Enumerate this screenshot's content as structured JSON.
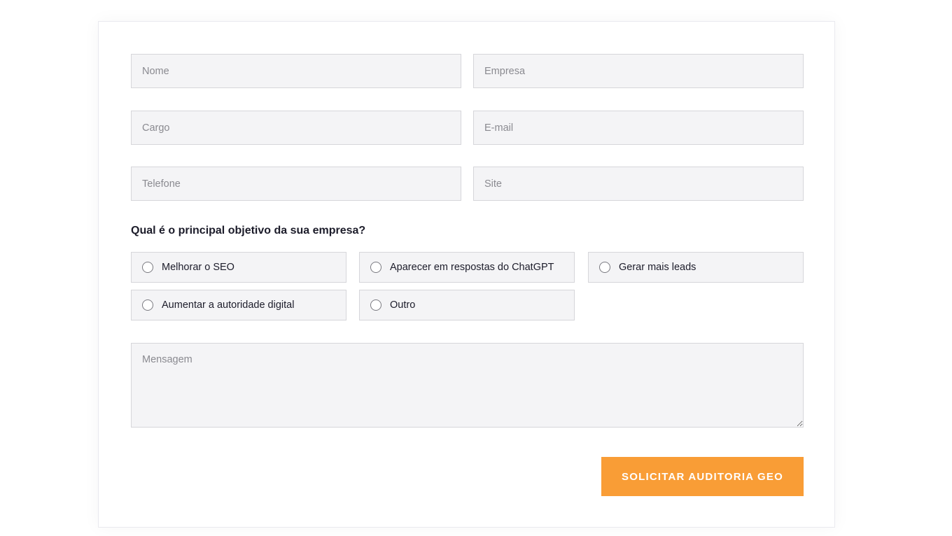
{
  "form": {
    "fields": {
      "nome": {
        "placeholder": "Nome",
        "value": ""
      },
      "empresa": {
        "placeholder": "Empresa",
        "value": ""
      },
      "cargo": {
        "placeholder": "Cargo",
        "value": ""
      },
      "email": {
        "placeholder": "E-mail",
        "value": ""
      },
      "telefone": {
        "placeholder": "Telefone",
        "value": ""
      },
      "site": {
        "placeholder": "Site",
        "value": ""
      }
    },
    "question": "Qual é o principal objetivo da sua empresa?",
    "options": [
      {
        "label": "Melhorar o SEO",
        "selected": false
      },
      {
        "label": "Aparecer em respostas do ChatGPT",
        "selected": false
      },
      {
        "label": "Gerar mais leads",
        "selected": false
      },
      {
        "label": "Aumentar a autoridade digital",
        "selected": false
      },
      {
        "label": "Outro",
        "selected": false
      }
    ],
    "message": {
      "placeholder": "Mensagem",
      "value": ""
    },
    "submit_label": "SOLICITAR AUDITORIA GEO"
  },
  "colors": {
    "accent": "#f99d36",
    "field_bg": "#f4f4f6",
    "field_border": "#d6d6da",
    "text": "#1c1c2a",
    "placeholder": "#8a8a90"
  }
}
